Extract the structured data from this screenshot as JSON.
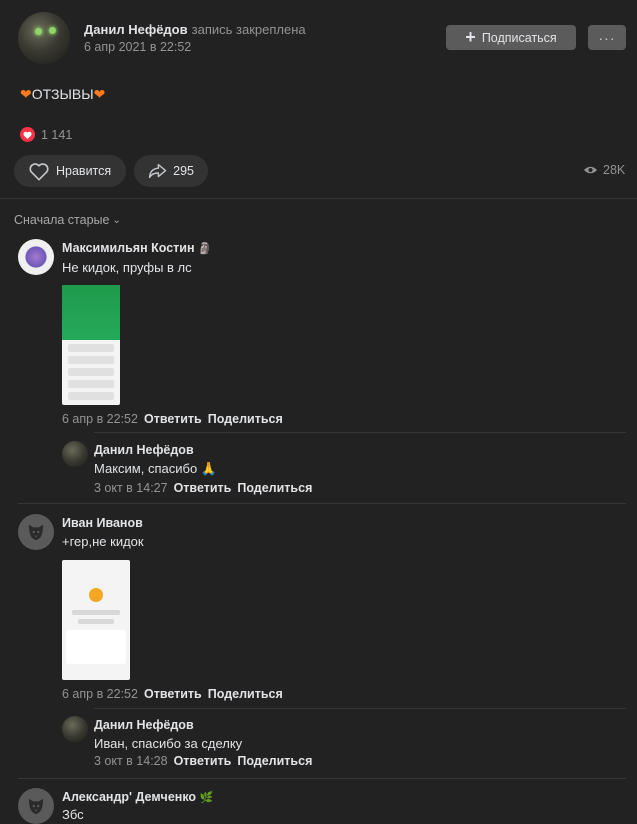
{
  "post": {
    "author": "Данил Нефёдов",
    "pinned_label": "запись закреплена",
    "date": "6 апр 2021 в 22:52",
    "subscribe_label": "Подписаться",
    "more_label": "···",
    "text": "ОТЗЫВЫ",
    "likes_count": "1 141",
    "like_label": "Нравится",
    "shares_count": "295",
    "views_count": "28K",
    "accent": "#ff3347"
  },
  "sort_label": "Сначала старые",
  "comments": [
    {
      "author": "Максимильян Костин",
      "badge": "🗿",
      "text": "Не кидок, пруфы в лс",
      "date": "6 апр в 22:52",
      "reply_label": "Ответить",
      "share_label": "Поделиться",
      "reply": {
        "author": "Данил Нефёдов",
        "text": "Максим, спасибо 🙏",
        "date": "3 окт в 14:27",
        "reply_label": "Ответить",
        "share_label": "Поделиться"
      }
    },
    {
      "author": "Иван Иванов",
      "text": "+гер,не кидок",
      "date": "6 апр в 22:52",
      "reply_label": "Ответить",
      "share_label": "Поделиться",
      "reply": {
        "author": "Данил Нефёдов",
        "text": "Иван, спасибо за сделку",
        "date": "3 окт в 14:28",
        "reply_label": "Ответить",
        "share_label": "Поделиться"
      }
    },
    {
      "author": "Александр' Демченко",
      "badge": "🌿",
      "text": "Збс"
    }
  ]
}
